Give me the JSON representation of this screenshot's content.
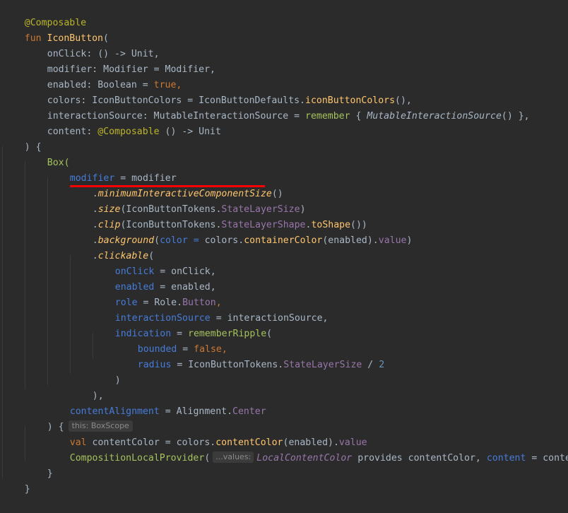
{
  "editor": {
    "theme": "darcula",
    "background": "#2b2b2b",
    "lines": {
      "l1_annotation": "@Composable",
      "l2_fun": "fun",
      "l2_name": "IconButton",
      "l2_paren": "(",
      "l3_name": "onClick",
      "l3_rest": ": () -> Unit,",
      "l4_name": "modifier",
      "l4_rest": ": Modifier = Modifier,",
      "l5_name": "enabled",
      "l5_type": ": Boolean = ",
      "l5_value": "true",
      "l5_comma": ",",
      "l6_name": "colors",
      "l6_rest": ": IconButtonColors = IconButtonDefaults.",
      "l6_call": "iconButtonColors",
      "l6_tail": "(),",
      "l7_name": "interactionSource",
      "l7_rest": ": MutableInteractionSource = ",
      "l7_remember": "remember",
      "l7_brace": " { ",
      "l7_ctor": "MutableInteractionSource",
      "l7_tail": "() },",
      "l8_name": "content",
      "l8_colon": ": ",
      "l8_ann": "@Composable",
      "l8_rest": " () -> Unit",
      "l9": ") {",
      "l10_box": "Box(",
      "l11_named": "modifier",
      "l11_rest": " = modifier",
      "l12_dot": ".",
      "l12_call": "minimumInteractiveComponentSize",
      "l12_tail": "()",
      "l13_dot": ".",
      "l13_call": "size",
      "l13_mid": "(IconButtonTokens.",
      "l13_prop": "StateLayerSize",
      "l13_tail": ")",
      "l14_dot": ".",
      "l14_call": "clip",
      "l14_mid": "(IconButtonTokens.",
      "l14_prop": "StateLayerShape",
      "l14_dot2": ".",
      "l14_call2": "toShape",
      "l14_tail": "())",
      "l15_dot": ".",
      "l15_call": "background",
      "l15_open": "(",
      "l15_named": "color",
      "l15_eq": " = ",
      "l15_colors": "colors.",
      "l15_call2": "containerColor",
      "l15_args": "(enabled).",
      "l15_prop": "value",
      "l15_tail": ")",
      "l16_dot": ".",
      "l16_call": "clickable",
      "l16_tail": "(",
      "l17_named": "onClick",
      "l17_rest": " = onClick,",
      "l18_named": "enabled",
      "l18_rest": " = enabled,",
      "l19_named": "role",
      "l19_rest": " = Role.",
      "l19_prop": "Button",
      "l19_tail": ",",
      "l20_named": "interactionSource",
      "l20_rest": " = interactionSource,",
      "l21_named": "indication",
      "l21_eq": " = ",
      "l21_call": "rememberRipple",
      "l21_tail": "(",
      "l22_named": "bounded",
      "l22_eq": " = ",
      "l22_value": "false",
      "l22_tail": ",",
      "l23_named": "radius",
      "l23_eq": " = IconButtonTokens.",
      "l23_prop": "StateLayerSize",
      "l23_op": " / ",
      "l23_num": "2",
      "l24": ")",
      "l25": "),",
      "l26_named": "contentAlignment",
      "l26_rest": " = Alignment.",
      "l26_prop": "Center",
      "l27_text": ") {",
      "l27_hint": "this: BoxScope",
      "l28_val": "val",
      "l28_rest": " contentColor = colors.",
      "l28_call": "contentColor",
      "l28_args": "(enabled).",
      "l28_prop": "value",
      "l29_call": "CompositionLocalProvider",
      "l29_open": "(",
      "l29_hint": "...values:",
      "l29_local": "LocalContentColor",
      "l29_provides": " provides contentColor, ",
      "l29_named": "content",
      "l29_rest": " = content)",
      "l30": "}",
      "l31": "}"
    }
  }
}
